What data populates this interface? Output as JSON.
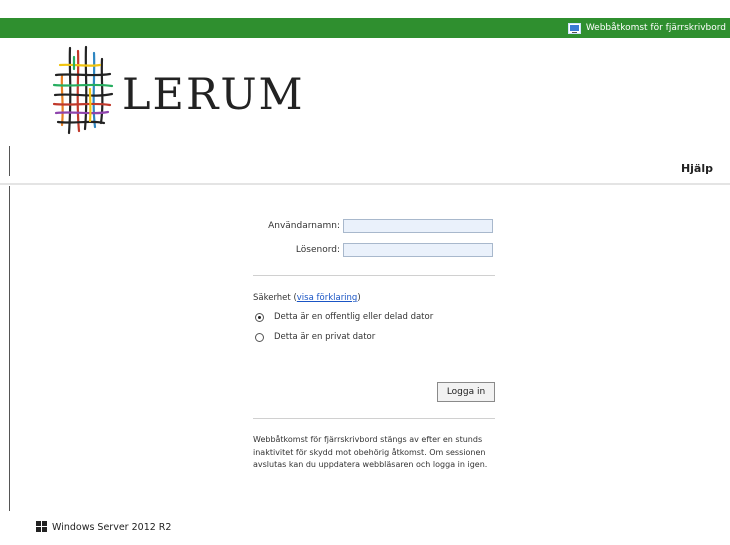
{
  "topbar": {
    "title": "Webbåtkomst för fjärrskrivbord",
    "icon": "remote-desktop-icon",
    "color": "#2f8f2f"
  },
  "brand": {
    "name": "LERUM",
    "logo_icon": "lerum-woven-grid-logo"
  },
  "header": {
    "help": "Hjälp"
  },
  "form": {
    "username_label": "Användarnamn:",
    "username_value": "",
    "password_label": "Lösenord:",
    "password_value": "",
    "security_label": "Säkerhet (",
    "security_link": "visa förklaring",
    "security_label_end": ")",
    "radio_public": "Detta är en offentlig eller delad dator",
    "radio_private": "Detta är en privat dator",
    "selected_option": "public",
    "login_button": "Logga in"
  },
  "notice": "Webbåtkomst för fjärrskrivbord stängs av efter en stunds inaktivitet för skydd mot obehörig åtkomst. Om sessionen avslutas kan du uppdatera webbläsaren och logga in igen.",
  "footer": {
    "text": "Windows Server 2012 R2",
    "icon": "windows-logo-icon"
  }
}
